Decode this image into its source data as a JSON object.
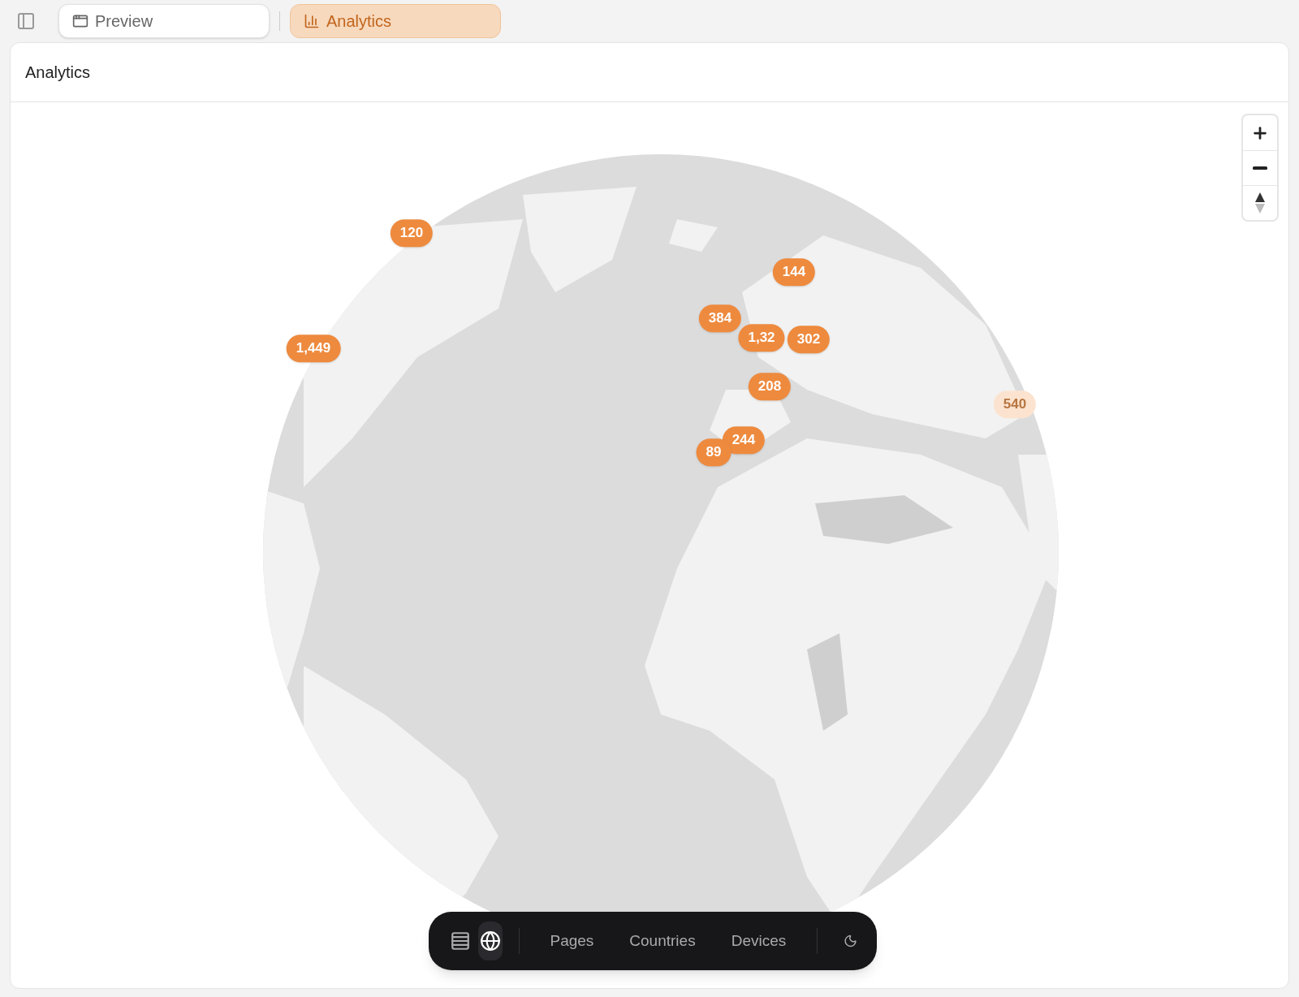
{
  "tabs": [
    {
      "label": "Preview",
      "selected": false,
      "kind": "preview"
    },
    {
      "label": "Analytics",
      "selected": true,
      "kind": "analytics"
    }
  ],
  "panel": {
    "title": "Analytics"
  },
  "map": {
    "kind": "picture",
    "markers": [
      {
        "count": "120",
        "faded": false
      },
      {
        "count": "1,449",
        "faded": false
      },
      {
        "count": "144",
        "faded": false
      },
      {
        "count": "384",
        "faded": false
      },
      {
        "count": "1,32",
        "faded": false
      },
      {
        "count": "302",
        "faded": false
      },
      {
        "count": "208",
        "faded": false
      },
      {
        "count": "244",
        "faded": false
      },
      {
        "count": "89",
        "faded": false
      },
      {
        "count": "540",
        "faded": true
      }
    ],
    "zoom_controls": [
      {
        "kind": "zoom-in"
      },
      {
        "kind": "zoom-out"
      },
      {
        "kind": "compass"
      }
    ]
  },
  "toolbar": {
    "views": [
      {
        "kind": "list",
        "selected": false
      },
      {
        "kind": "globe",
        "selected": true
      }
    ],
    "links": [
      "Pages",
      "Countries",
      "Devices"
    ]
  }
}
